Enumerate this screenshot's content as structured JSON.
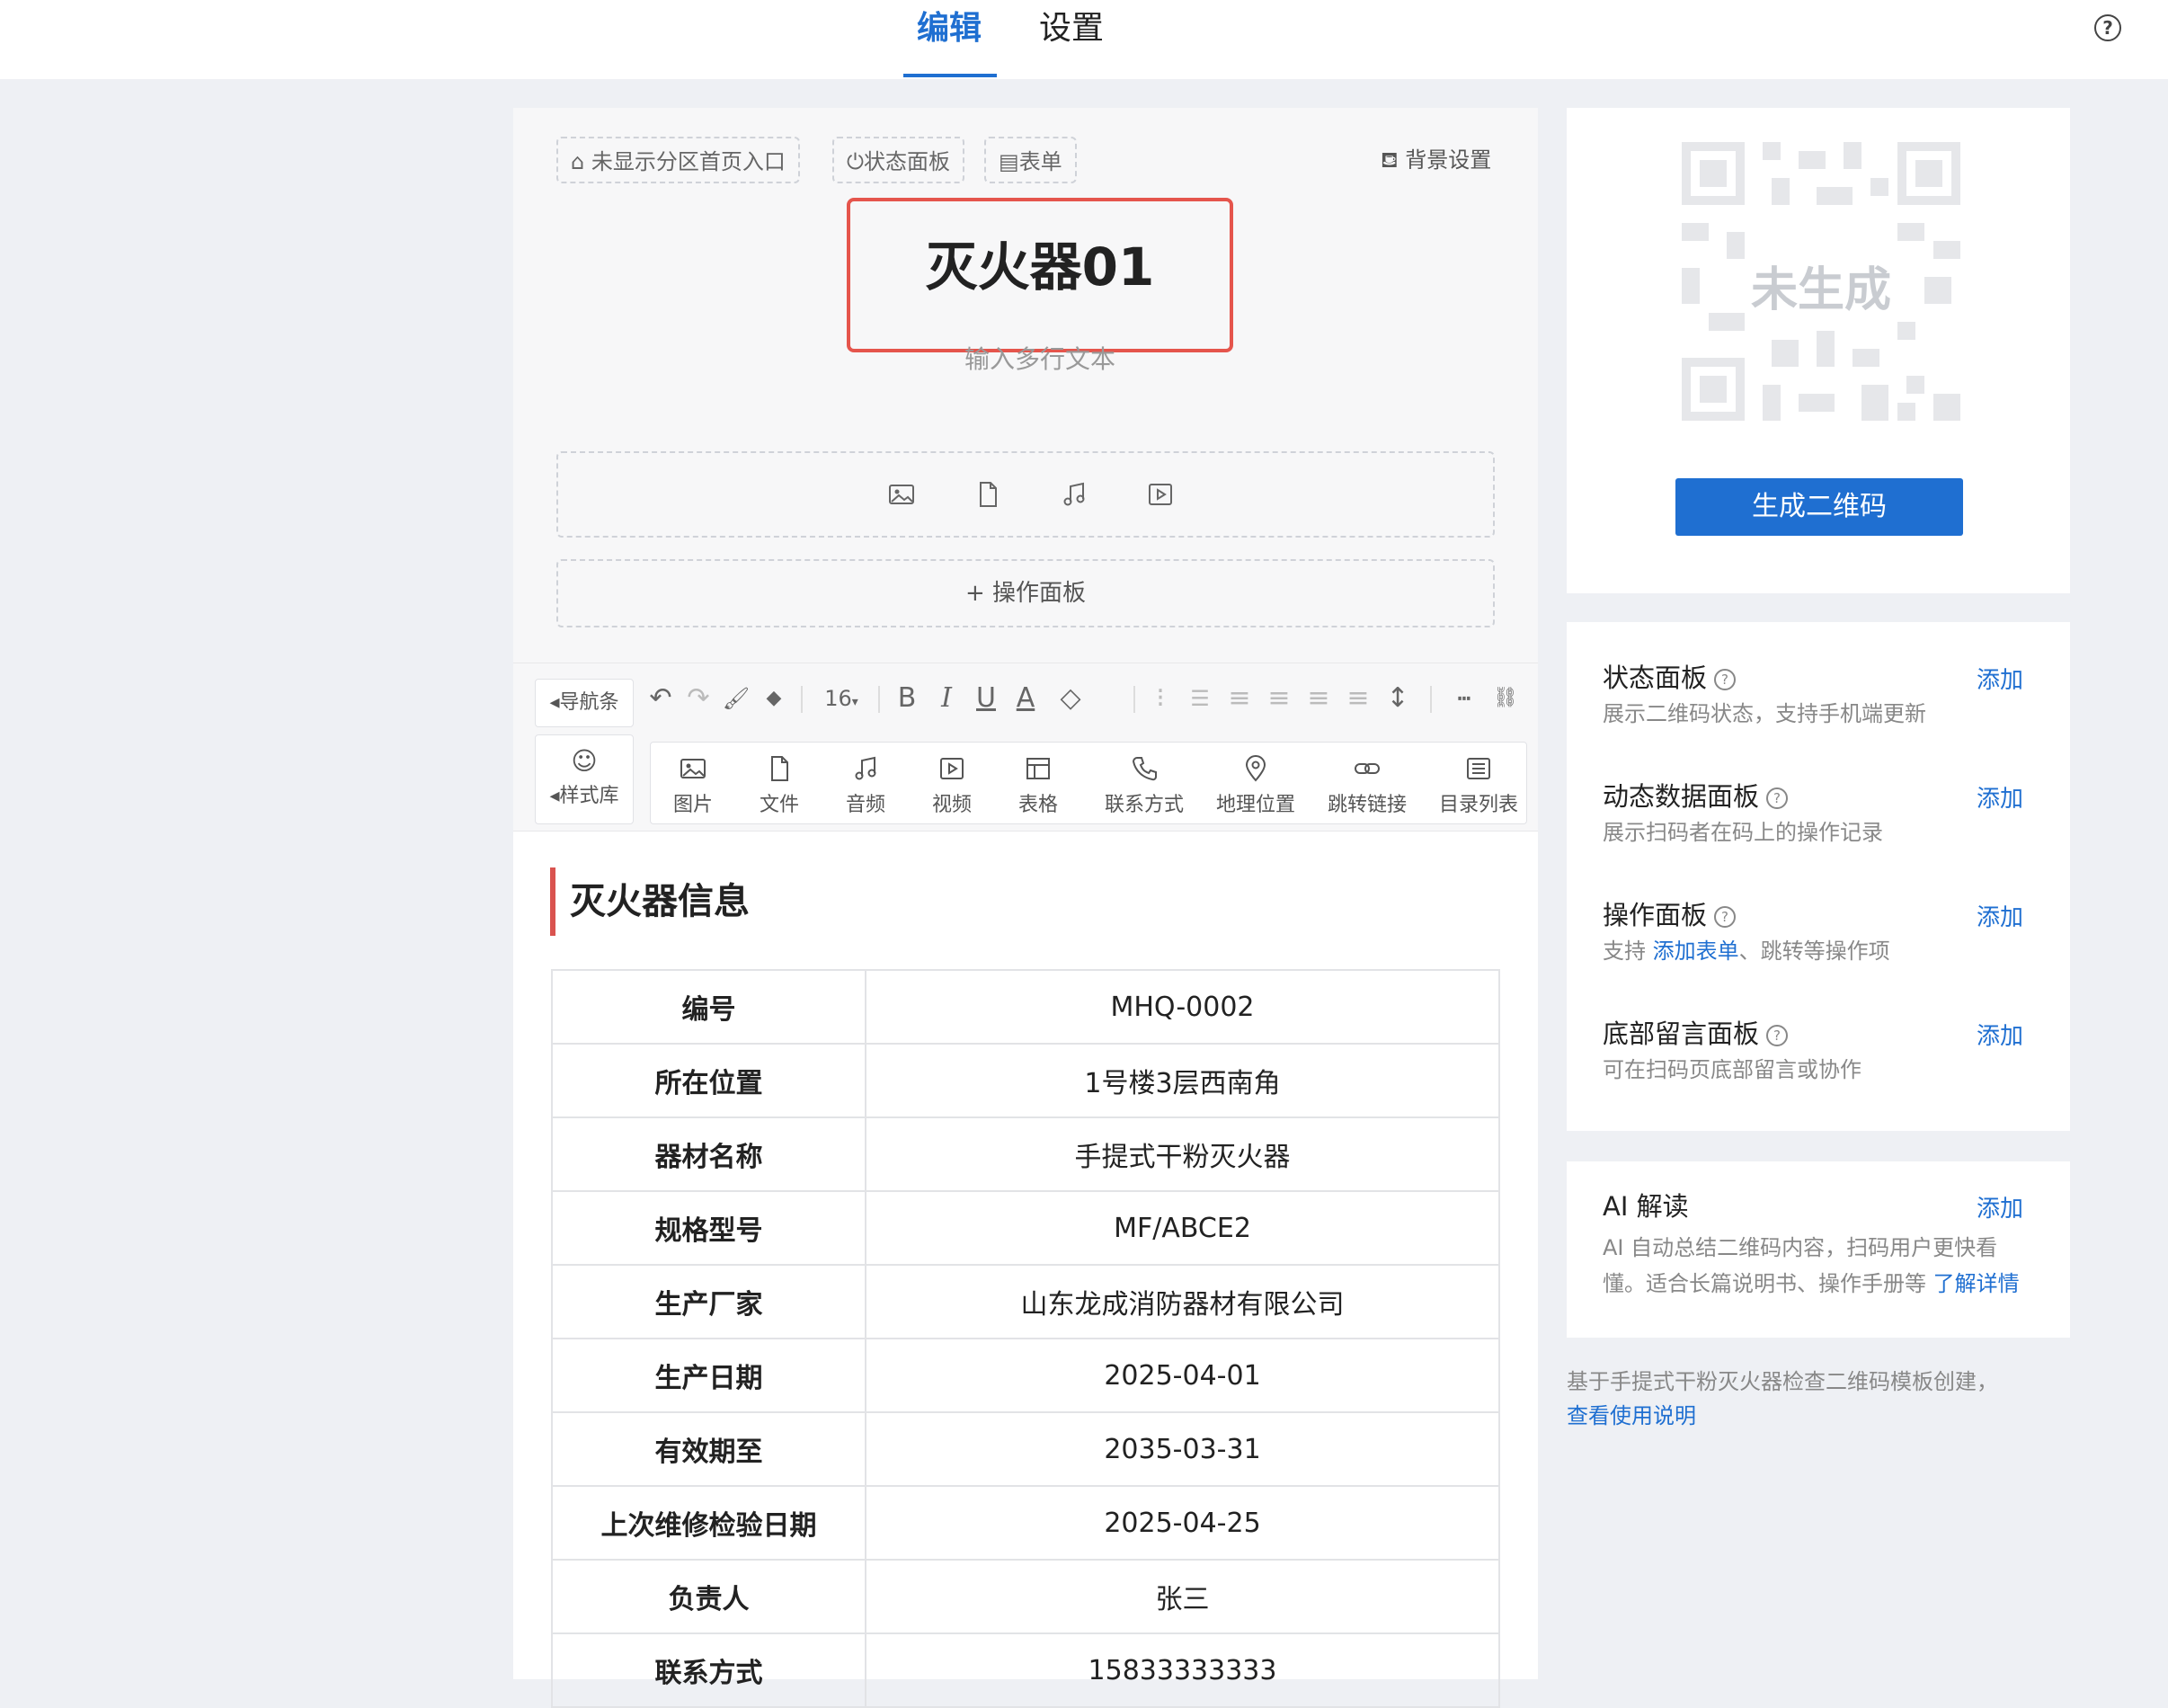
{
  "header": {
    "tabs": [
      {
        "label": "编辑",
        "active": true
      },
      {
        "label": "设置",
        "active": false
      }
    ],
    "help_glyph": "?"
  },
  "editor": {
    "chips": [
      {
        "icon": "home-icon",
        "label": "未显示分区首页入口"
      },
      {
        "icon": "power-icon",
        "label": "状态面板"
      },
      {
        "icon": "form-icon",
        "label": "表单"
      }
    ],
    "background_settings": "背景设置",
    "title": "灭火器01",
    "subtitle_placeholder": "输入多行文本",
    "media_icons": [
      "image-icon",
      "file-icon",
      "music-icon",
      "video-icon"
    ],
    "operation_panel_label": "+ 操作面板"
  },
  "toolbar": {
    "nav_label": "导航条",
    "style_label": "样式库",
    "font_size": "16",
    "format_buttons": [
      {
        "name": "undo-icon",
        "glyph": "↶"
      },
      {
        "name": "redo-icon",
        "glyph": "↷"
      },
      {
        "name": "format-painter-icon",
        "glyph": "🖌"
      },
      {
        "name": "eraser-icon",
        "glyph": "◆"
      },
      {
        "name": "bold-icon",
        "glyph": "B"
      },
      {
        "name": "italic-icon",
        "glyph": "I"
      },
      {
        "name": "underline-icon",
        "glyph": "U"
      },
      {
        "name": "font-color-icon",
        "glyph": "A"
      },
      {
        "name": "highlight-icon",
        "glyph": "◇"
      },
      {
        "name": "ordered-list-icon",
        "glyph": "⁝"
      },
      {
        "name": "bullet-list-icon",
        "glyph": "☰"
      },
      {
        "name": "align-left-icon",
        "glyph": "≡"
      },
      {
        "name": "align-center-icon",
        "glyph": "≡"
      },
      {
        "name": "align-right-icon",
        "glyph": "≡"
      },
      {
        "name": "align-justify-icon",
        "glyph": "≡"
      },
      {
        "name": "line-height-icon",
        "glyph": "↕"
      },
      {
        "name": "divider-icon",
        "glyph": "┅"
      },
      {
        "name": "link-icon",
        "glyph": "⛓"
      }
    ],
    "insert_items": [
      {
        "icon": "image-icon",
        "label": "图片"
      },
      {
        "icon": "file-icon",
        "label": "文件"
      },
      {
        "icon": "music-icon",
        "label": "音频"
      },
      {
        "icon": "video-icon",
        "label": "视频"
      },
      {
        "icon": "table-icon",
        "label": "表格"
      },
      {
        "icon": "phone-icon",
        "label": "联系方式"
      },
      {
        "icon": "location-icon",
        "label": "地理位置"
      },
      {
        "icon": "link-chain-icon",
        "label": "跳转链接"
      },
      {
        "icon": "toc-icon",
        "label": "目录列表"
      }
    ]
  },
  "content": {
    "section_title": "灭火器信息",
    "rows": [
      {
        "key": "编号",
        "value": "MHQ-0002"
      },
      {
        "key": "所在位置",
        "value": "1号楼3层西南角"
      },
      {
        "key": "器材名称",
        "value": "手提式干粉灭火器"
      },
      {
        "key": "规格型号",
        "value": "MF/ABCE2"
      },
      {
        "key": "生产厂家",
        "value": "山东龙成消防器材有限公司"
      },
      {
        "key": "生产日期",
        "value": "2025-04-01"
      },
      {
        "key": "有效期至",
        "value": "2035-03-31"
      },
      {
        "key": "上次维修检验日期",
        "value": "2025-04-25"
      },
      {
        "key": "负责人",
        "value": "张三"
      },
      {
        "key": "联系方式",
        "value": "15833333333"
      }
    ]
  },
  "qr_card": {
    "placeholder_label": "未生成",
    "generate_button": "生成二维码"
  },
  "panels": [
    {
      "title": "状态面板",
      "desc": "展示二维码状态，支持手机端更新",
      "add": "添加"
    },
    {
      "title": "动态数据面板",
      "desc": "展示扫码者在码上的操作记录",
      "add": "添加"
    },
    {
      "title": "操作面板",
      "desc_prefix": "支持 ",
      "desc_link": "添加表单",
      "desc_suffix": "、跳转等操作项",
      "add": "添加"
    },
    {
      "title": "底部留言面板",
      "desc": "可在扫码页底部留言或协作",
      "add": "添加"
    }
  ],
  "ai_card": {
    "title": "AI 解读",
    "add": "添加",
    "desc_line1": "AI 自动总结二维码内容，扫码用户更快看",
    "desc_line2": "懂。适合长篇说明书、操作手册等 ",
    "desc_link": "了解详情"
  },
  "footer": {
    "note": "基于手提式干粉灭火器检查二维码模板创建，",
    "link": "查看使用说明"
  }
}
